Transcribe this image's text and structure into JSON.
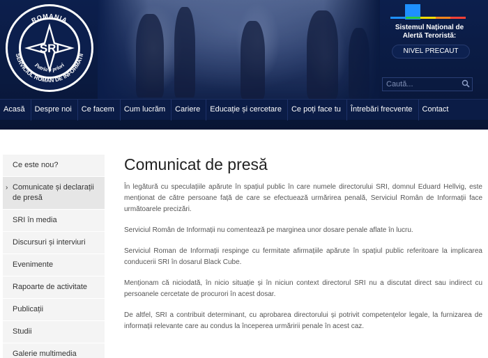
{
  "header": {
    "logo": {
      "top_text": "ROMANIA",
      "center_text": "SRI",
      "motto": "Patria a priori",
      "bottom_text": "SERVICIUL ROMAN DE INFORMATII"
    },
    "alert": {
      "title": "Sistemul Național de Alertă Teroristă:",
      "level": "NIVEL PRECAUT",
      "colors": [
        "#1e90ff",
        "#2ecc40",
        "#ffdc00",
        "#ff851b",
        "#ff4136"
      ]
    },
    "search": {
      "placeholder": "Caută..."
    }
  },
  "nav": {
    "items": [
      {
        "label": "Acasă"
      },
      {
        "label": "Despre noi"
      },
      {
        "label": "Ce facem"
      },
      {
        "label": "Cum lucrăm"
      },
      {
        "label": "Cariere"
      },
      {
        "label": "Educație și cercetare"
      },
      {
        "label": "Ce poți face tu"
      },
      {
        "label": "Întrebări frecvente"
      },
      {
        "label": "Contact"
      }
    ]
  },
  "sidebar": {
    "items": [
      {
        "label": "Ce este nou?"
      },
      {
        "label": "Comunicate și declarații de presă",
        "active": true
      },
      {
        "label": "SRI în media"
      },
      {
        "label": "Discursuri și interviuri"
      },
      {
        "label": "Evenimente"
      },
      {
        "label": "Rapoarte de activitate"
      },
      {
        "label": "Publicații"
      },
      {
        "label": "Studii"
      },
      {
        "label": "Galerie multimedia"
      }
    ]
  },
  "main": {
    "title": "Comunicat de presă",
    "paragraphs": [
      "În legătură cu speculațiile apărute în spațiul public în care numele directorului SRI, domnul Eduard Hellvig, este menționat de către persoane față de care se efectuează urmărirea penală, Serviciul Român de Informații  face următoarele precizări.",
      "Serviciul Român de Informații  nu comentează pe marginea unor dosare penale aflate în lucru.",
      "Serviciul Roman de Informații respinge cu fermitate afirmațiile apărute în spațiul public referitoare la implicarea conducerii SRI în dosarul Black Cube.",
      "Menționam că niciodată, în nicio situație și în niciun context directorul SRI nu a discutat direct sau indirect cu persoanele cercetate de procurori în acest dosar.",
      "De altfel, SRI a contribuit determinant, cu aprobarea directorului și potrivit competențelor legale, la furnizarea de informații relevante care au condus la începerea urmăririi penale în acest caz."
    ]
  }
}
